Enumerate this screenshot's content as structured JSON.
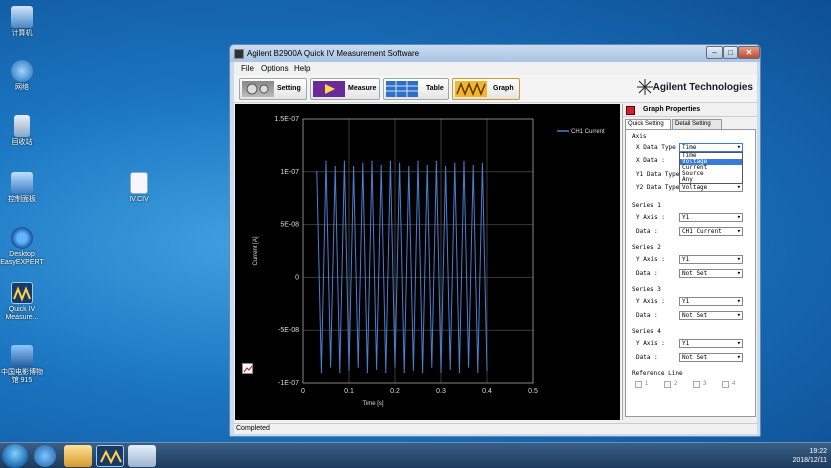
{
  "desktop": {
    "icons": [
      {
        "label": "计算机",
        "icon": "computer-icon"
      },
      {
        "label": "网络",
        "icon": "network-icon"
      },
      {
        "label": "回收站",
        "icon": "recycle-bin-icon"
      },
      {
        "label": "控制面板",
        "icon": "control-panel-icon"
      },
      {
        "label": "Desktop EasyEXPERT",
        "icon": "easyexpert-icon"
      },
      {
        "label": "Quick IV Measure...",
        "icon": "quick-iv-icon"
      },
      {
        "label": "中国电影博物馆 915",
        "icon": "folder-icon"
      },
      {
        "label": "IV.CIV",
        "icon": "file-icon"
      }
    ]
  },
  "window": {
    "title": "Agilent B2900A Quick IV Measurement Software",
    "menu": [
      "File",
      "Options",
      "Help"
    ],
    "toolbar": {
      "setting": "Setting",
      "measure": "Measure",
      "table": "Table",
      "graph": "Graph"
    },
    "brand": "Agilent Technologies",
    "status": "Completed"
  },
  "graph_properties": {
    "title": "Graph Properties",
    "tabs": [
      "Quick Setting",
      "Detail Setting"
    ],
    "axis": {
      "heading": "Axis",
      "x_data_type_label": "X Data Type :",
      "x_data_type_value": "Time",
      "x_data_label": "X Data :",
      "y1_data_type_label": "Y1 Data Type :",
      "y2_data_type_label": "Y2 Data Type :",
      "y2_data_type_value": "Voltage",
      "dropdown_options": [
        "Time",
        "Voltage",
        "Current",
        "Source",
        "Any"
      ],
      "dropdown_selected": "Voltage"
    },
    "series": [
      {
        "heading": "Series 1",
        "y_axis_label": "Y Axis :",
        "y_axis": "Y1",
        "data_label": "Data :",
        "data": "CH1 Current"
      },
      {
        "heading": "Series 2",
        "y_axis_label": "Y Axis :",
        "y_axis": "Y1",
        "data_label": "Data :",
        "data": "Not Set"
      },
      {
        "heading": "Series 3",
        "y_axis_label": "Y Axis :",
        "y_axis": "Y1",
        "data_label": "Data :",
        "data": "Not Set"
      },
      {
        "heading": "Series 4",
        "y_axis_label": "Y Axis :",
        "y_axis": "Y1",
        "data_label": "Data :",
        "data": "Not Set"
      }
    ],
    "reference_line": {
      "heading": "Reference Line",
      "items": [
        "1",
        "2",
        "3",
        "4"
      ]
    }
  },
  "chart_data": {
    "type": "line",
    "xlabel": "Time [s]",
    "ylabel": "Current [A]",
    "xlim": [
      0,
      0.5
    ],
    "ylim": [
      -1e-07,
      1.5e-07
    ],
    "x_ticks": [
      "0",
      "0.1",
      "0.2",
      "0.3",
      "0.4",
      "0.5"
    ],
    "y_ticks": [
      "1.5E-07",
      "1E-07",
      "5E-08",
      "0",
      "-5E-08",
      "-1E-07"
    ],
    "grid": true,
    "legend_position": "top-right",
    "series": [
      {
        "name": "CH1 Current",
        "color": "#4a7fd0",
        "x": [
          0.03,
          0.04,
          0.05,
          0.06,
          0.07,
          0.08,
          0.09,
          0.1,
          0.11,
          0.12,
          0.13,
          0.14,
          0.15,
          0.16,
          0.17,
          0.18,
          0.19,
          0.2,
          0.21,
          0.22,
          0.23,
          0.24,
          0.25,
          0.26,
          0.27,
          0.28,
          0.29,
          0.3,
          0.31,
          0.32,
          0.33,
          0.34,
          0.35,
          0.36,
          0.37,
          0.38,
          0.39,
          0.4
        ],
        "y": [
          1e-07,
          -9e-08,
          1.1e-07,
          -8.5e-08,
          1.05e-07,
          -9e-08,
          1.1e-07,
          -8.8e-08,
          1.05e-07,
          -8.5e-08,
          1.08e-07,
          -9e-08,
          1.1e-07,
          -8.7e-08,
          1.06e-07,
          -9e-08,
          1.1e-07,
          -8.5e-08,
          1.08e-07,
          -9e-08,
          1.05e-07,
          -8.8e-08,
          1.1e-07,
          -9e-08,
          1.06e-07,
          -8.5e-08,
          1.1e-07,
          -9e-08,
          1.05e-07,
          -8.7e-08,
          1.08e-07,
          -9e-08,
          1.1e-07,
          -8.5e-08,
          1.06e-07,
          -9e-08,
          1.08e-07,
          -8.8e-08
        ]
      }
    ]
  },
  "taskbar": {
    "time": "19:22",
    "date": "2018/12/11"
  }
}
